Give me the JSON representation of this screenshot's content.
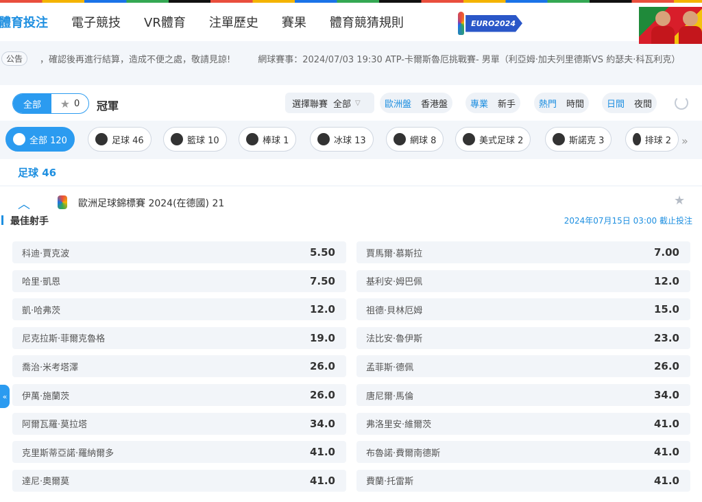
{
  "topnav": {
    "items": [
      "體育投注",
      "電子競技",
      "VR體育",
      "注單歷史",
      "賽果",
      "體育競猜規則"
    ],
    "euro_badge": "EURO2024"
  },
  "notice": {
    "badge": "公告",
    "message": "，確認後再進行結算，造成不便之處，敬請見諒!",
    "message2": "網球賽事：2024/07/03 19:30 ATP-卡爾斯魯厄挑戰賽- 男單（利亞姆·加夫列里德斯VS 約瑟夫·科瓦利克）"
  },
  "filter": {
    "all_label": "全部",
    "fav_count": "0",
    "champion_label": "冠軍",
    "league_select_label": "選擇聯賽",
    "league_select_value": "全部",
    "odds_types": [
      "歐洲盤",
      "香港盤"
    ],
    "levels": [
      "專業",
      "新手"
    ],
    "sort_options": [
      "熱門",
      "時間"
    ],
    "day_options": [
      "日間",
      "夜間"
    ]
  },
  "sports": [
    {
      "label": "全部 120",
      "icon": "grid-icon"
    },
    {
      "label": "足球 46",
      "icon": "soccer-ball-icon"
    },
    {
      "label": "籃球 10",
      "icon": "basketball-icon"
    },
    {
      "label": "棒球 1",
      "icon": "baseball-icon"
    },
    {
      "label": "冰球 13",
      "icon": "hockey-puck-icon"
    },
    {
      "label": "網球 8",
      "icon": "tennis-ball-icon"
    },
    {
      "label": "美式足球 2",
      "icon": "american-football-icon"
    },
    {
      "label": "斯諾克 3",
      "icon": "snooker-icon"
    },
    {
      "label": "排球 2",
      "icon": "volleyball-icon"
    }
  ],
  "section": {
    "title": "足球 46"
  },
  "league": {
    "name": "歐洲足球錦標賽 2024(在德國) 21",
    "market_title": "最佳射手",
    "deadline": "2024年07月15日 03:00 截止投注"
  },
  "odds": [
    {
      "name": "科迪·賈克波",
      "price": "5.50"
    },
    {
      "name": "賈馬爾·慕斯拉",
      "price": "7.00"
    },
    {
      "name": "哈里·凱恩",
      "price": "7.50"
    },
    {
      "name": "基利安·姆巴佩",
      "price": "12.0"
    },
    {
      "name": "凱·哈弗茨",
      "price": "12.0"
    },
    {
      "name": "祖德·貝林厄姆",
      "price": "15.0"
    },
    {
      "name": "尼克拉斯·菲爾克魯格",
      "price": "19.0"
    },
    {
      "name": "法比安·魯伊斯",
      "price": "23.0"
    },
    {
      "name": "喬治·米考塔澤",
      "price": "26.0"
    },
    {
      "name": "孟菲斯·德佩",
      "price": "26.0"
    },
    {
      "name": "伊萬·施蘭茨",
      "price": "26.0"
    },
    {
      "name": "唐尼爾·馬倫",
      "price": "34.0"
    },
    {
      "name": "阿爾瓦羅·莫拉塔",
      "price": "34.0"
    },
    {
      "name": "弗洛里安·維爾茨",
      "price": "41.0"
    },
    {
      "name": "克里斯蒂亞諾·羅納爾多",
      "price": "41.0"
    },
    {
      "name": "布魯諾·費爾南德斯",
      "price": "41.0"
    },
    {
      "name": "達尼·奧爾莫",
      "price": "41.0"
    },
    {
      "name": "費蘭·托雷斯",
      "price": "41.0"
    }
  ],
  "side_tab_label": "«"
}
